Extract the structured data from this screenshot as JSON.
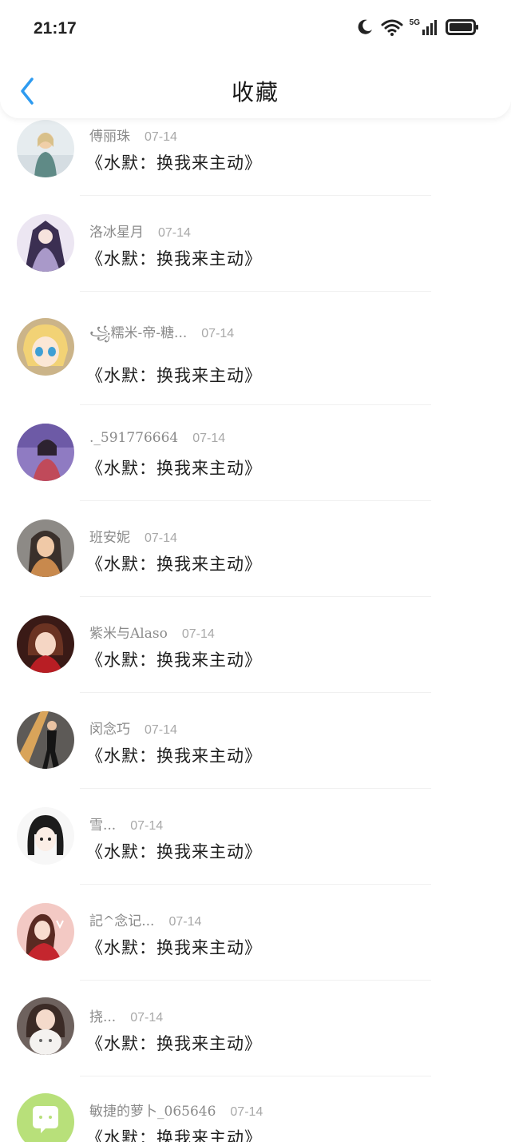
{
  "status_bar": {
    "time": "21:17",
    "network": "5G"
  },
  "header": {
    "title": "收藏"
  },
  "favorites": [
    {
      "name": "傅丽珠",
      "date": "07-14",
      "title": "《水默：换我来主动》"
    },
    {
      "name": "洛冰星月",
      "date": "07-14",
      "title": "《水默：换我来主动》"
    },
    {
      "name": "꧁糯米-帝-糖...",
      "date": "07-14",
      "title": "《水默：换我来主动》"
    },
    {
      "name": "._591776664",
      "date": "07-14",
      "title": "《水默：换我来主动》"
    },
    {
      "name": "班安妮",
      "date": "07-14",
      "title": "《水默：换我来主动》"
    },
    {
      "name": "紫米与Alaso",
      "date": "07-14",
      "title": "《水默：换我来主动》"
    },
    {
      "name": "闵念巧",
      "date": "07-14",
      "title": "《水默：换我来主动》"
    },
    {
      "name": "雪...",
      "date": "07-14",
      "title": "《水默：换我来主动》"
    },
    {
      "name": "記^念记...",
      "date": "07-14",
      "title": "《水默：换我来主动》"
    },
    {
      "name": "挠...",
      "date": "07-14",
      "title": "《水默：换我来主动》"
    },
    {
      "name": "敏捷的萝卜_065646",
      "date": "07-14",
      "title": "《水默：换我来主动》"
    }
  ],
  "colors": {
    "accent": "#2e9bf0",
    "default_avatar": "#b8e07a"
  }
}
